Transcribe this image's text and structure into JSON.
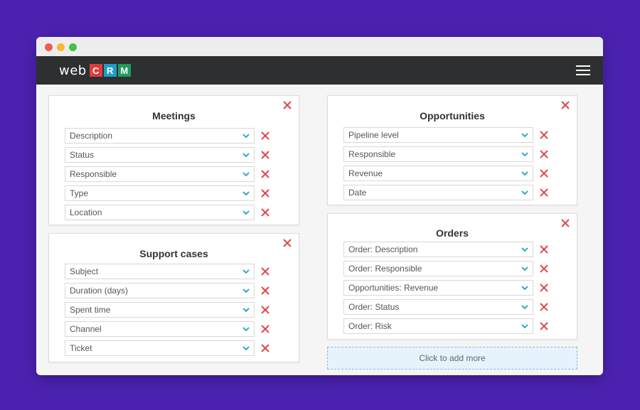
{
  "logo": {
    "text": "web",
    "letters": [
      "C",
      "R",
      "M"
    ]
  },
  "cards": {
    "meetings": {
      "title": "Meetings",
      "fields": [
        "Description",
        "Status",
        "Responsible",
        "Type",
        "Location"
      ]
    },
    "support": {
      "title": "Support cases",
      "fields": [
        "Subject",
        "Duration (days)",
        "Spent time",
        "Channel",
        "Ticket"
      ]
    },
    "opportunities": {
      "title": "Opportunities",
      "fields": [
        "Pipeline level",
        "Responsible",
        "Revenue",
        "Date"
      ]
    },
    "orders": {
      "title": "Orders",
      "fields": [
        "Order: Description",
        "Order: Responsible",
        "Opportunities: Revenue",
        "Order: Status",
        "Order: Risk"
      ]
    }
  },
  "add_more_label": "Click to add more",
  "colors": {
    "background": "#4b22b0",
    "appbar": "#2e2f30",
    "delete": "#e0474c",
    "chevron": "#1ba0c9",
    "add_more_bg": "#e6f3fc"
  }
}
